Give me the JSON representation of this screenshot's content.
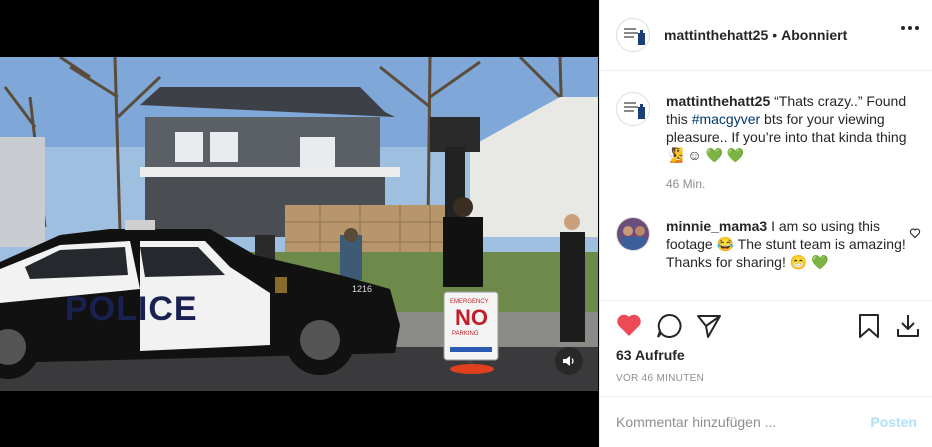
{
  "post": {
    "username": "mattinthehatt25",
    "dot": "•",
    "follow_status": "Abonniert"
  },
  "caption": {
    "username": "mattinthehatt25",
    "text_before_tag": "“Thats crazy..” Found this ",
    "hashtag": "#macgyver",
    "text_after_tag": " bts for your viewing pleasure.. If you’re into that kinda thing 🧏 ☺ 💚 💚",
    "time": "46 Min."
  },
  "comment": {
    "username": "minnie_mama3",
    "text": "I am so using this footage 😂 The stunt team is amazing! Thanks for sharing! 😁 💚"
  },
  "stats": {
    "views": "63 Aufrufe",
    "ago": "VOR 46 MINUTEN"
  },
  "composer": {
    "placeholder": "Kommentar hinzufügen ...",
    "post_label": "Posten"
  },
  "video": {
    "police_text": "POLICE",
    "car_number": "1216",
    "sign_top": "EMERGENCY",
    "sign_main": "NO",
    "sign_bottom": "PARKING"
  },
  "colors": {
    "like": "#ed4956",
    "link": "#00376b",
    "post_disabled": "#b2dffc"
  },
  "icons": [
    "heart-icon",
    "comment-icon",
    "share-icon",
    "bookmark-icon",
    "download-icon",
    "more-icon",
    "volume-icon"
  ]
}
